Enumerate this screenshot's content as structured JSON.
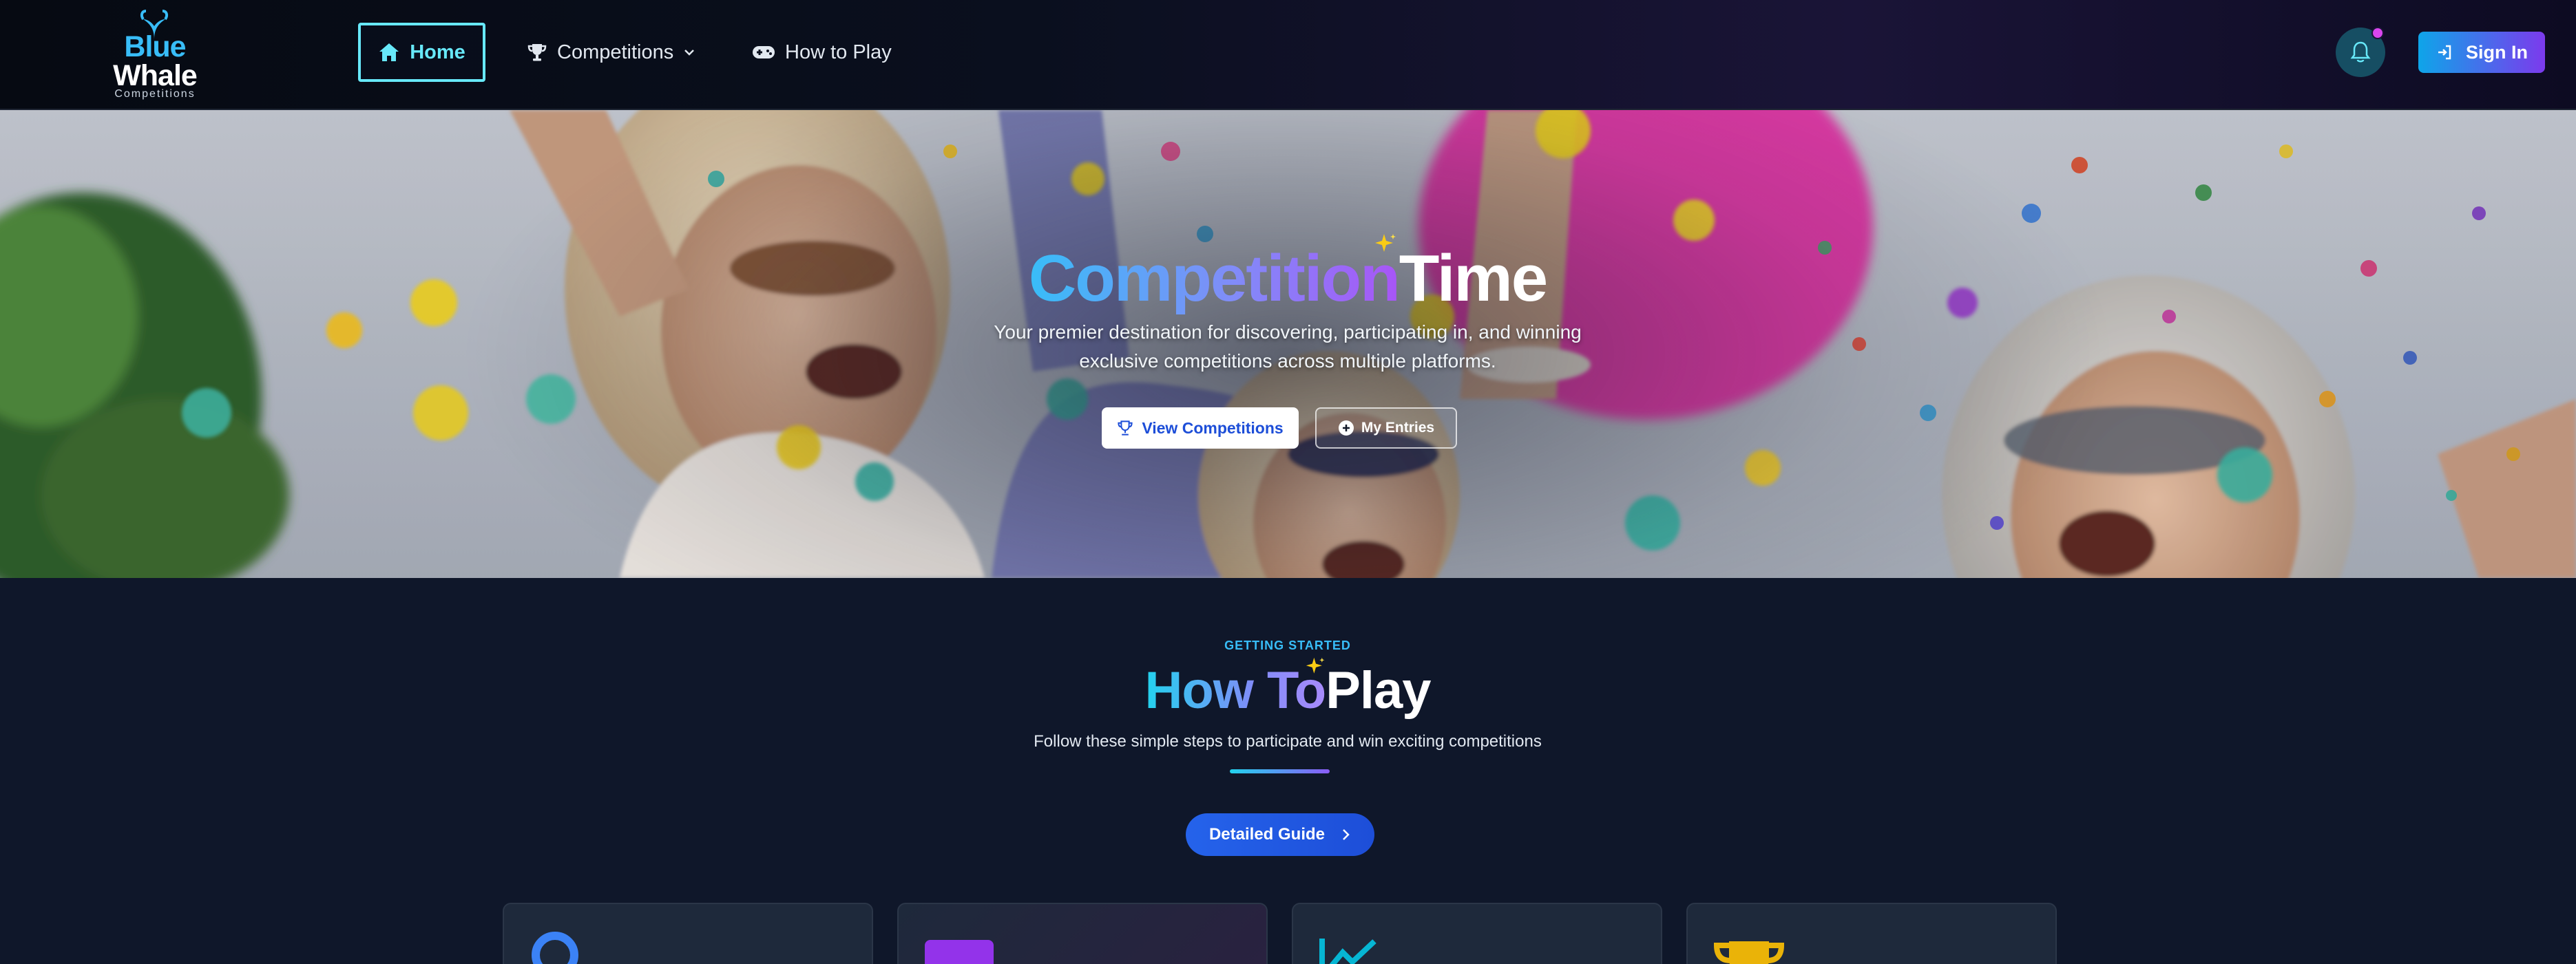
{
  "nav": {
    "logo": {
      "line1": "Blue",
      "line2": "Whale",
      "line3": "Competitions"
    },
    "home_label": "Home",
    "competitions_label": "Competitions",
    "how_to_play_label": "How to Play",
    "sign_in_label": "Sign In"
  },
  "hero": {
    "title_part1": "Competition",
    "title_part2": "Time",
    "subtitle_line1": "Your premier destination for discovering, participating in, and winning",
    "subtitle_line2": "exclusive competitions across multiple platforms.",
    "view_competitions_label": "View Competitions",
    "my_entries_label": "My Entries"
  },
  "how_to_play": {
    "eyebrow": "GETTING STARTED",
    "title_part1": "How To",
    "title_part2": "Play",
    "subtitle": "Follow these simple steps to participate and win exciting competitions",
    "guide_button_label": "Detailed Guide"
  },
  "cards": [
    {
      "icon": "user-icon",
      "color": "#3b82f6"
    },
    {
      "icon": "ticket-icon",
      "color": "#9333ea"
    },
    {
      "icon": "chart-line-icon",
      "color": "#06b6d4"
    },
    {
      "icon": "trophy-icon",
      "color": "#eab308"
    }
  ],
  "colors": {
    "accent_cyan": "#67e8f9",
    "brand_blue": "#38bdf8",
    "notification_dot": "#d946ef",
    "background": "#0f172a"
  }
}
